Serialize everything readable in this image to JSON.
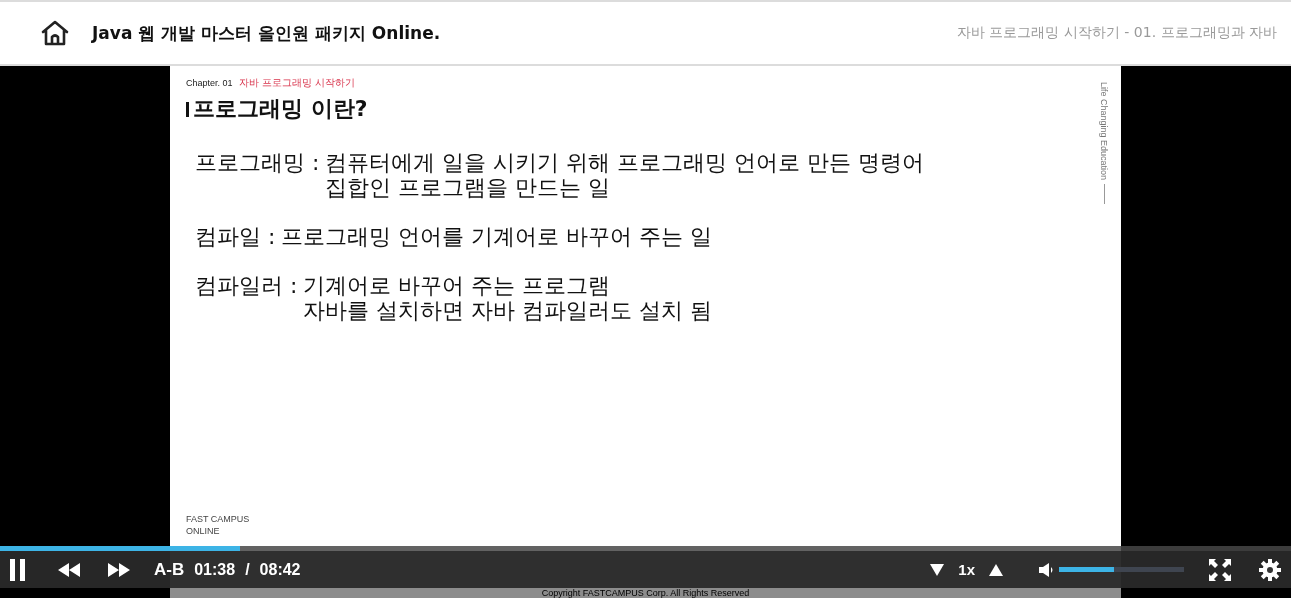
{
  "header": {
    "title": "Java 웹 개발 마스터 올인원 패키지 Online.",
    "lesson": "자바 프로그래밍 시작하기 - 01. 프로그래밍과 자바"
  },
  "slide": {
    "chapter": "Chapter. 01",
    "chapter_title": "자바 프로그래밍 시작하기",
    "heading": "프로그래밍 이란?",
    "definitions": [
      {
        "term": "프로그래밍 :",
        "lines": [
          "컴퓨터에게 일을 시키기 위해 프로그래밍 언어로 만든 명령어",
          "집합인 프로그램을 만드는 일"
        ]
      },
      {
        "term": "컴파일 :",
        "lines": [
          "프로그래밍 언어를 기계어로 바꾸어 주는 일"
        ]
      },
      {
        "term": "컴파일러 :",
        "lines": [
          "기계어로 바꾸어 주는 프로그램",
          "자바를 설치하면 자바 컴파일러도 설치 됨"
        ]
      }
    ],
    "side_text": "Life Changing Education",
    "footer_brand": [
      "FAST CAMPUS",
      "ONLINE"
    ],
    "copyright": "Copyright FASTCAMPUS Corp. All Rights Reserved"
  },
  "player": {
    "progress": {
      "level": 0.186
    },
    "playing": true,
    "ab_label": "A-B",
    "current_time": "01:38",
    "separator": "/",
    "duration": "08:42",
    "speed": "1x",
    "volume": {
      "level": 0.44
    }
  }
}
